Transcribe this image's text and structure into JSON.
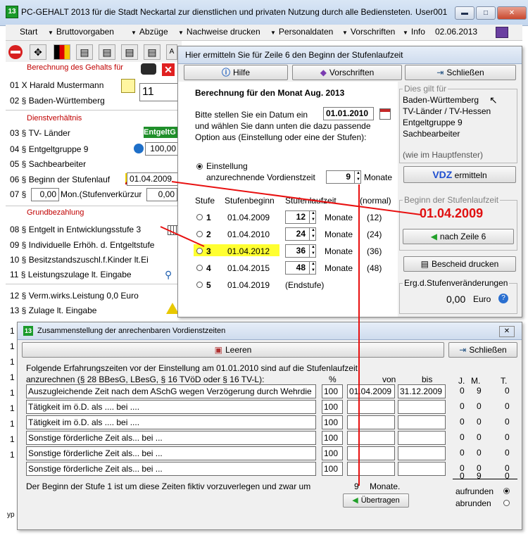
{
  "app": {
    "title": "PC-GEHALT 2013 für die Stadt Neckartal zur dienstlichen und privaten Nutzung durch alle Bediensteten.",
    "user": "User001",
    "icon_label": "13",
    "buttons": {
      "minimize": "▬",
      "maximize": "□",
      "close": "✕"
    }
  },
  "menu": {
    "items": [
      "Start",
      "Bruttovorgaben",
      "Abzüge",
      "Nachweise drucken",
      "Personaldaten",
      "Vorschriften",
      "Info"
    ],
    "date": "02.06.2013"
  },
  "left": {
    "sec1": "Berechnung des Gehalts für",
    "r01": "01 X  Harald Mustermann",
    "r01_count": "11",
    "r02": "02 §  Baden-Württemberg",
    "sec2": "Dienstverhältnis",
    "r03": "03 §  TV- Länder",
    "r03_badge": "EntgeltG",
    "r04": "04 §  Entgeltgruppe 9",
    "r04_value": "100,00",
    "r05": "05 §  Sachbearbeiter",
    "r06": "06 §  Beginn der Stufenlauf",
    "r06_value": "01.04.2009",
    "r07_prefix": "07 §",
    "r07_value": "0,00",
    "r07_label": "Mon.(Stufenverkürzur",
    "r07_value2": "0,00",
    "sec3": "Grundbezahlung",
    "r08": "08 §  Entgelt in Entwicklungsstufe 3",
    "r09": "09 §  Individuelle Erhöh. d. Entgeltstufe",
    "r10": "10 §  Besitzstandszuschl.f.Kinder lt.Ei",
    "r11": "11 §  Leistungszulage lt. Eingabe",
    "r12": "12 §  Verm.wirks.Leistung     0,0 Euro",
    "r13": "13 §  Zulage lt. Eingabe",
    "partial": [
      "1",
      "1",
      "1",
      "1",
      "1",
      "1",
      "1",
      "1",
      "1"
    ],
    "bottom_partial": "yp"
  },
  "dialog1": {
    "title": "Hier ermitteln Sie für Zeile 6 den Beginn der Stufenlaufzeit",
    "hilfe": "Hilfe",
    "vorschriften": "Vorschriften",
    "schliessen": "Schließen",
    "heading": "Berechnung für den Monat Aug. 2013",
    "prompt_l1": "Bitte stellen Sie ein Datum ein",
    "prompt_l2": "und wählen Sie dann unten die dazu passende",
    "prompt_l3": "Option aus (Einstellung oder eine der Stufen):",
    "date_value": "01.01.2010",
    "einst_l1": "Einstellung",
    "einst_l2": "anzurechnende Vordienstzeit",
    "vdz_value": "9",
    "monate": "Monate",
    "hdr_stufe": "Stufe",
    "hdr_beginn": "Stufenbeginn",
    "hdr_laufzeit": "Stufenlaufzeit",
    "hdr_normal": "(normal)",
    "stufen": [
      {
        "num": "1",
        "date": "01.04.2009",
        "months": "12",
        "unit": "Monate",
        "normal": "(12)"
      },
      {
        "num": "2",
        "date": "01.04.2010",
        "months": "24",
        "unit": "Monate",
        "normal": "(24)"
      },
      {
        "num": "3",
        "date": "01.04.2012",
        "months": "36",
        "unit": "Monate",
        "normal": "(36)"
      },
      {
        "num": "4",
        "date": "01.04.2015",
        "months": "48",
        "unit": "Monate",
        "normal": "(48)"
      },
      {
        "num": "5",
        "date": "01.04.2019",
        "endstufe": "(Endstufe)"
      }
    ],
    "gilt_label": "Dies gilt für",
    "gilt_lines": [
      "Baden-Württemberg",
      "TV-Länder    / TV-Hessen",
      "Entgeltgruppe 9",
      "Sachbearbeiter"
    ],
    "gilt_note": "(wie im Hauptfenster)",
    "vdz_btn_bold": "VDZ",
    "vdz_btn_rest": " ermitteln",
    "beginn_label": "Beginn der Stufenlaufzeit",
    "beginn_value": "01.04.2009",
    "nach_zeile": "nach Zeile 6",
    "bescheid": "Bescheid drucken",
    "erg_label": "Erg.d.Stufenveränderungen",
    "erg_value": "0,00",
    "erg_unit": "Euro"
  },
  "dialog2": {
    "icon_label": "13",
    "title": "Zusammenstellung der anrechenbaren Vordienstzeiten",
    "leeren": "Leeren",
    "schliessen": "Schließen",
    "intro_l1": "Folgende Erfahrungszeiten vor der Einstellung am 01.01.2010 sind auf die Stufenlaufzeit",
    "intro_l2": "anzurechnen (§ 28 BBesG, LBesG, § 16 TVöD oder § 16 TV-L):",
    "col_pct": "%",
    "col_von": "von",
    "col_bis": "bis",
    "col_j": "J.",
    "col_m": "M.",
    "col_t": "T.",
    "rows": [
      {
        "label": "Auszugleichende Zeit nach dem ASchG wegen Verzögerung durch Wehrdie",
        "pct": "100",
        "von": "01.04.2009",
        "bis": "31.12.2009",
        "j": "0",
        "m": "9",
        "t": "0"
      },
      {
        "label": "Tätigkeit im ö.D. als .... bei ....",
        "pct": "100",
        "von": "",
        "bis": "",
        "j": "0",
        "m": "0",
        "t": "0"
      },
      {
        "label": "Tätigkeit im ö.D. als .... bei ....",
        "pct": "100",
        "von": "",
        "bis": "",
        "j": "0",
        "m": "0",
        "t": "0"
      },
      {
        "label": "Sonstige förderliche Zeit als... bei ...",
        "pct": "100",
        "von": "",
        "bis": "",
        "j": "0",
        "m": "0",
        "t": "0"
      },
      {
        "label": "Sonstige förderliche Zeit als... bei ...",
        "pct": "100",
        "von": "",
        "bis": "",
        "j": "0",
        "m": "0",
        "t": "0"
      },
      {
        "label": "Sonstige förderliche Zeit als... bei ...",
        "pct": "100",
        "von": "",
        "bis": "",
        "j": "0",
        "m": "0",
        "t": "0"
      }
    ],
    "total_j": "0",
    "total_m": "9",
    "total_t": "0",
    "footer_text": "Der Beginn der Stufe 1 ist um diese Zeiten fiktiv vorzuverlegen und zwar um",
    "footer_value": "9",
    "footer_unit": "Monate.",
    "uebertragen": "Übertragen",
    "aufrunden": "aufrunden",
    "abrunden": "abrunden"
  }
}
